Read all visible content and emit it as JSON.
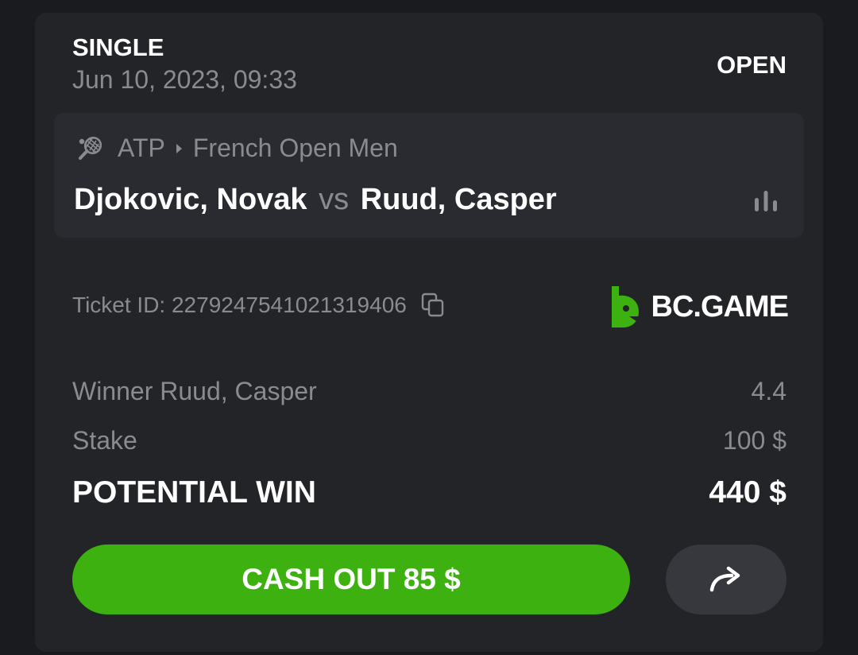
{
  "bet": {
    "type": "SINGLE",
    "date": "Jun 10, 2023, 09:33",
    "status": "OPEN"
  },
  "match": {
    "league": "ATP",
    "tournament": "French Open Men",
    "team_home": "Djokovic, Novak",
    "vs": "vs",
    "team_away": "Ruud, Casper",
    "sport_icon": "tennis-racket-icon",
    "stats_icon": "bar-chart-icon"
  },
  "ticket": {
    "label": "Ticket ID: 2279247541021319406",
    "copy_icon": "copy-icon"
  },
  "brand": {
    "name": "BC.GAME",
    "accent": "#3db10f"
  },
  "selection": {
    "label": "Winner Ruud, Casper",
    "odds": "4.4"
  },
  "stake": {
    "label": "Stake",
    "value": "100 $"
  },
  "potential_win": {
    "label": "POTENTIAL WIN",
    "value": "440 $"
  },
  "actions": {
    "cashout_label": "CASH OUT 85 $",
    "share_icon": "share-arrow-icon"
  },
  "colors": {
    "background": "#1a1b1f",
    "card": "#232428",
    "match_box": "#2a2b30",
    "muted_text": "#8a8b90",
    "cashout_green": "#3db10f"
  }
}
